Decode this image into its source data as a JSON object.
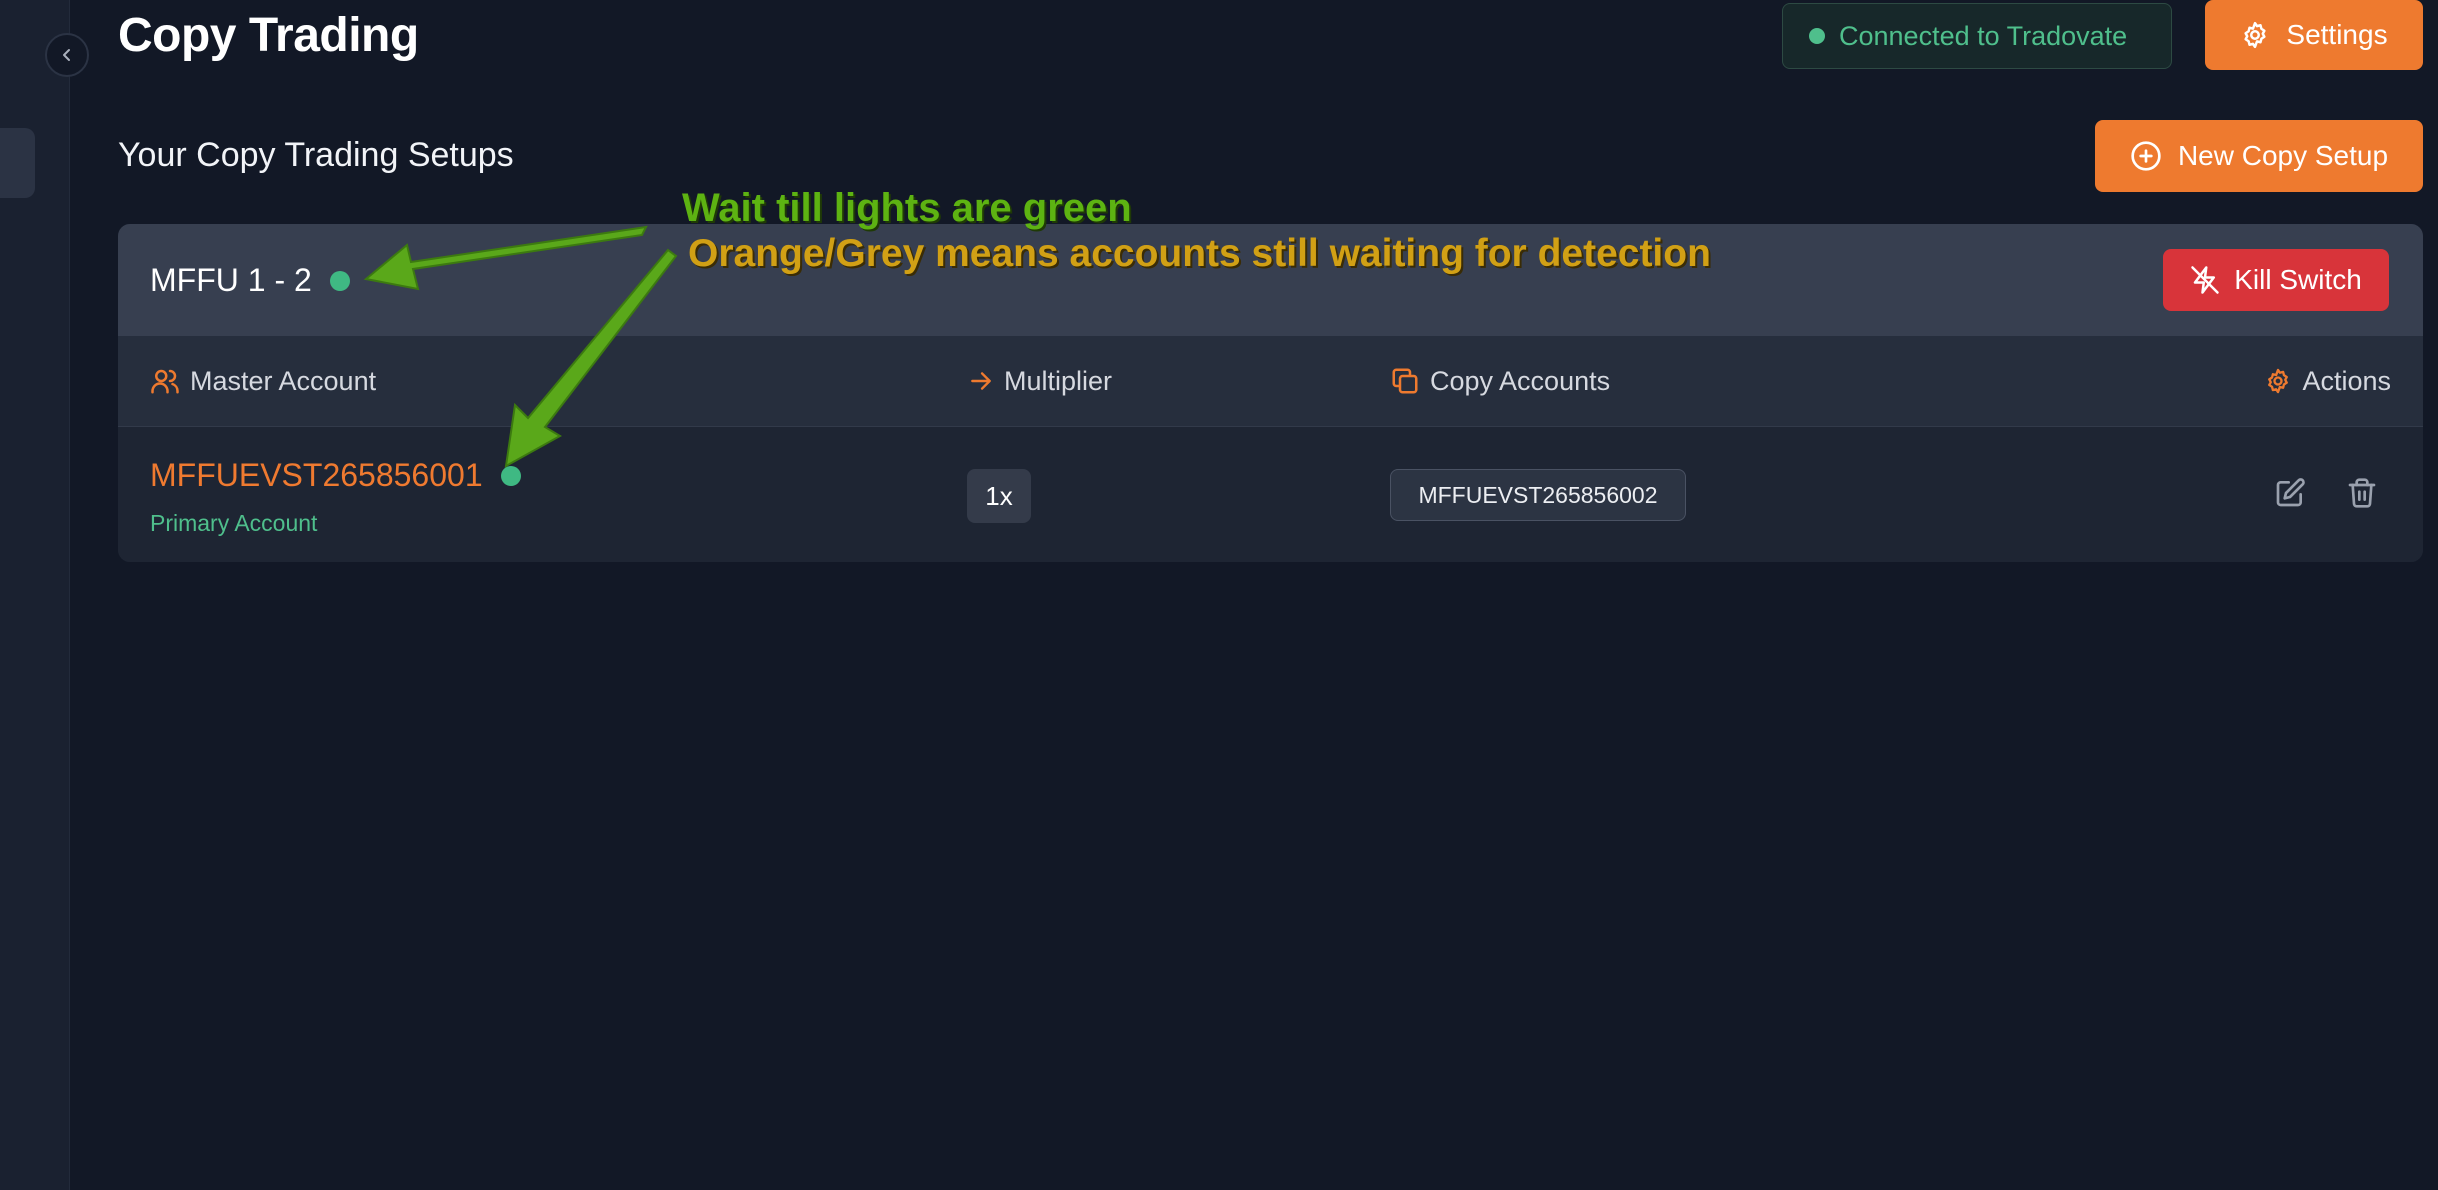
{
  "header": {
    "title": "Copy Trading",
    "connection_status": "Connected to Tradovate",
    "settings_label": "Settings"
  },
  "section": {
    "title": "Your Copy Trading Setups",
    "new_setup_label": "New Copy Setup"
  },
  "setup": {
    "name": "MFFU 1 - 2",
    "status": "green",
    "kill_switch_label": "Kill Switch",
    "columns": {
      "master": "Master Account",
      "multiplier": "Multiplier",
      "copy": "Copy Accounts",
      "actions": "Actions"
    },
    "row": {
      "master_account": "MFFUEVST265856001",
      "master_sub": "Primary Account",
      "multiplier": "1x",
      "copy_account": "MFFUEVST265856002"
    }
  },
  "annotations": {
    "line1": "Wait till lights are green",
    "line2": "Orange/Grey means accounts still waiting for detection"
  },
  "colors": {
    "accent": "#ee7a2f",
    "status_green": "#3fb983",
    "danger": "#d8343a",
    "background": "#121826"
  },
  "icons": [
    "chevron-left-icon",
    "gear-icon",
    "plus-circle-icon",
    "zap-off-icon",
    "users-icon",
    "arrow-right-icon",
    "copy-icon",
    "edit-icon",
    "trash-icon"
  ]
}
